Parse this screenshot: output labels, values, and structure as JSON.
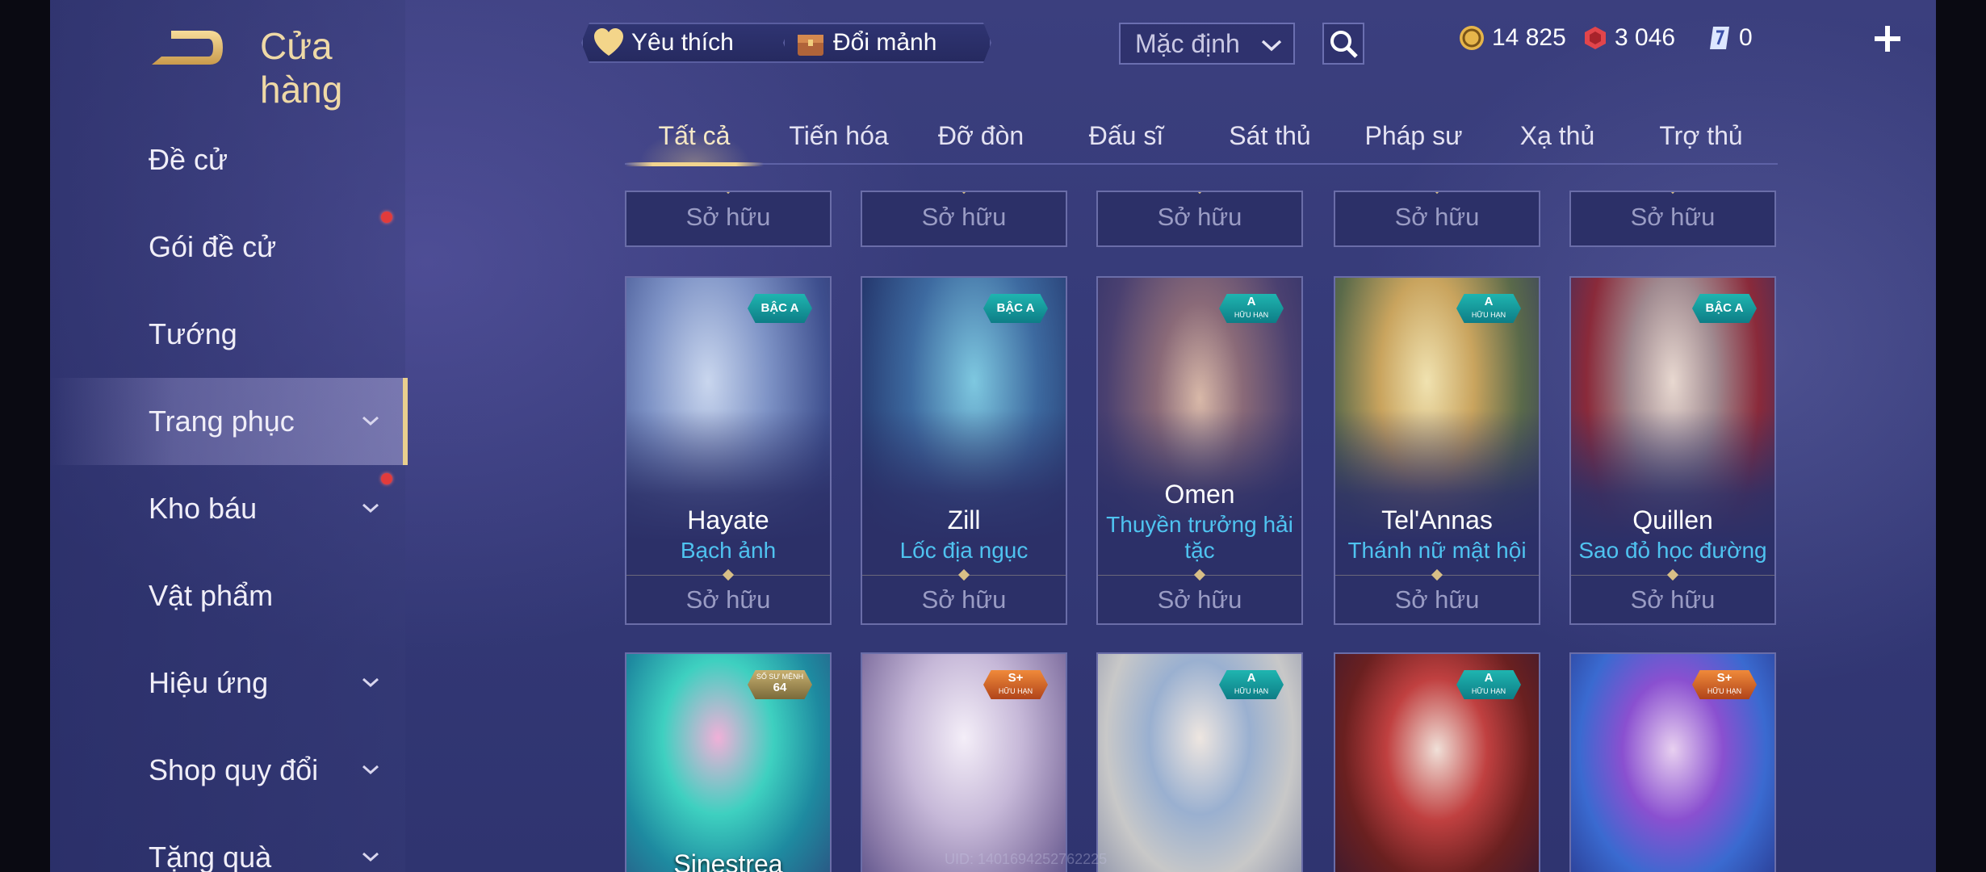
{
  "header": {
    "title": "Cửa hàng",
    "favorite_label": "Yêu thích",
    "exchange_label": "Đổi mảnh",
    "sort_value": "Mặc định"
  },
  "currencies": {
    "gold": "14 825",
    "rubies": "3 046",
    "tickets": "0"
  },
  "sidebar": {
    "items": [
      {
        "label": "Đề cử"
      },
      {
        "label": "Gói đề cử"
      },
      {
        "label": "Tướng"
      },
      {
        "label": "Trang phục"
      },
      {
        "label": "Kho báu"
      },
      {
        "label": "Vật phẩm"
      },
      {
        "label": "Hiệu ứng"
      },
      {
        "label": "Shop quy đổi"
      },
      {
        "label": "Tặng quà"
      }
    ]
  },
  "tabs": [
    "Tất cả",
    "Tiến hóa",
    "Đỡ đòn",
    "Đấu sĩ",
    "Sát thủ",
    "Pháp sư",
    "Xạ thủ",
    "Trợ thủ"
  ],
  "owned_label": "Sở hữu",
  "cards_row1": [
    {
      "hero": "Hayate",
      "skin": "Bạch ảnh",
      "badge": "BẬC A",
      "badge_sub": ""
    },
    {
      "hero": "Zill",
      "skin": "Lốc địa ngục",
      "badge": "BẬC A",
      "badge_sub": ""
    },
    {
      "hero": "Omen",
      "skin": "Thuyền trưởng hải tặc",
      "badge": "A",
      "badge_sub": "HỮU HẠN"
    },
    {
      "hero": "Tel'Annas",
      "skin": "Thánh nữ mật hội",
      "badge": "A",
      "badge_sub": "HỮU HẠN"
    },
    {
      "hero": "Quillen",
      "skin": "Sao đỏ học đường",
      "badge": "BẬC A",
      "badge_sub": ""
    }
  ],
  "cards_row2": [
    {
      "hero": "Sinestrea",
      "badge": "64",
      "badge_sub": "SỐ SƯ MỆNH"
    },
    {
      "hero": "",
      "badge": "S+",
      "badge_sub": "HỮU HẠN"
    },
    {
      "hero": "",
      "badge": "A",
      "badge_sub": "HỮU HẠN"
    },
    {
      "hero": "",
      "badge": "A",
      "badge_sub": "HỮU HẠN"
    },
    {
      "hero": "",
      "badge": "S+",
      "badge_sub": "HỮU HẠN"
    }
  ],
  "uid_text": "UID: 1401694252762225"
}
